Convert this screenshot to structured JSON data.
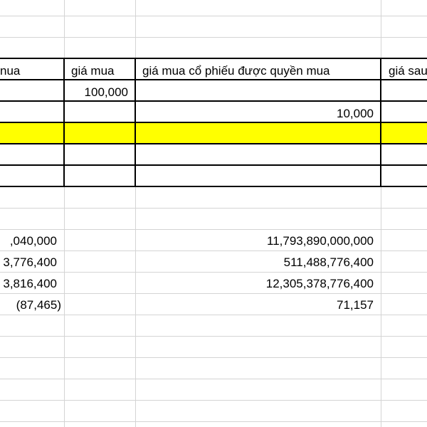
{
  "header_row": {
    "col_a": "nua",
    "col_b": "giá mua",
    "col_c": "giá mua cổ phiếu được quyền mua",
    "col_d": "giá sau"
  },
  "input_row_1": {
    "col_b": "100,000"
  },
  "input_row_2": {
    "col_c": "10,000"
  },
  "results": [
    {
      "col_a": ",040,000",
      "col_c": "11,793,890,000,000"
    },
    {
      "col_a": "3,776,400",
      "col_c": "511,488,776,400"
    },
    {
      "col_a": "3,816,400",
      "col_c": "12,305,378,776,400"
    },
    {
      "col_a": "(87,465)",
      "col_c": "71,157"
    }
  ],
  "colors": {
    "highlight_row": "#ffff00",
    "gridline": "#d4d4d4",
    "border": "#000000"
  }
}
